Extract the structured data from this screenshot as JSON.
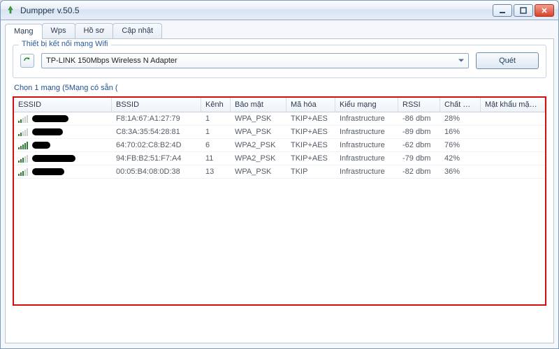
{
  "window": {
    "title": "Dumpper v.50.5"
  },
  "tabs": [
    {
      "label": "Mạng",
      "active": true
    },
    {
      "label": "Wps"
    },
    {
      "label": "Hồ sơ"
    },
    {
      "label": "Cập nhật"
    }
  ],
  "adapterGroup": {
    "title": "Thiết bị kết nối mạng Wifi",
    "selected": "TP-LINK 150Mbps Wireless N Adapter",
    "scanLabel": "Quét"
  },
  "statusLine": "Chọn 1 mạng (5Mạng có sẵn (",
  "columns": {
    "essid": "ESSID",
    "bssid": "BSSID",
    "channel": "Kênh",
    "security": "Bảo mật",
    "encryption": "Mã hóa",
    "nettype": "Kiểu mạng",
    "rssi": "RSSI",
    "quality": "Chất …",
    "password": "Mật khẩu mặc định"
  },
  "rows": [
    {
      "essid_len": 52,
      "bssid": "F8:1A:67:A1:27:79",
      "ch": "1",
      "sec": "WPA_PSK",
      "enc": "TKIP+AES",
      "net": "Infrastructure",
      "rssi": "-86 dbm",
      "qual": "28%",
      "sig": "low"
    },
    {
      "essid_len": 44,
      "bssid": "C8:3A:35:54:28:81",
      "ch": "1",
      "sec": "WPA_PSK",
      "enc": "TKIP+AES",
      "net": "Infrastructure",
      "rssi": "-89 dbm",
      "qual": "16%",
      "sig": "low"
    },
    {
      "essid_len": 26,
      "bssid": "64:70:02:C8:B2:4D",
      "ch": "6",
      "sec": "WPA2_PSK",
      "enc": "TKIP+AES",
      "net": "Infrastructure",
      "rssi": "-62 dbm",
      "qual": "76%",
      "sig": "full"
    },
    {
      "essid_len": 62,
      "bssid": "94:FB:B2:51:F7:A4",
      "ch": "11",
      "sec": "WPA2_PSK",
      "enc": "TKIP+AES",
      "net": "Infrastructure",
      "rssi": "-79 dbm",
      "qual": "42%",
      "sig": "mid"
    },
    {
      "essid_len": 46,
      "bssid": "00:05:B4:08:0D:38",
      "ch": "13",
      "sec": "WPA_PSK",
      "enc": "TKIP",
      "net": "Infrastructure",
      "rssi": "-82 dbm",
      "qual": "36%",
      "sig": "mid"
    }
  ]
}
